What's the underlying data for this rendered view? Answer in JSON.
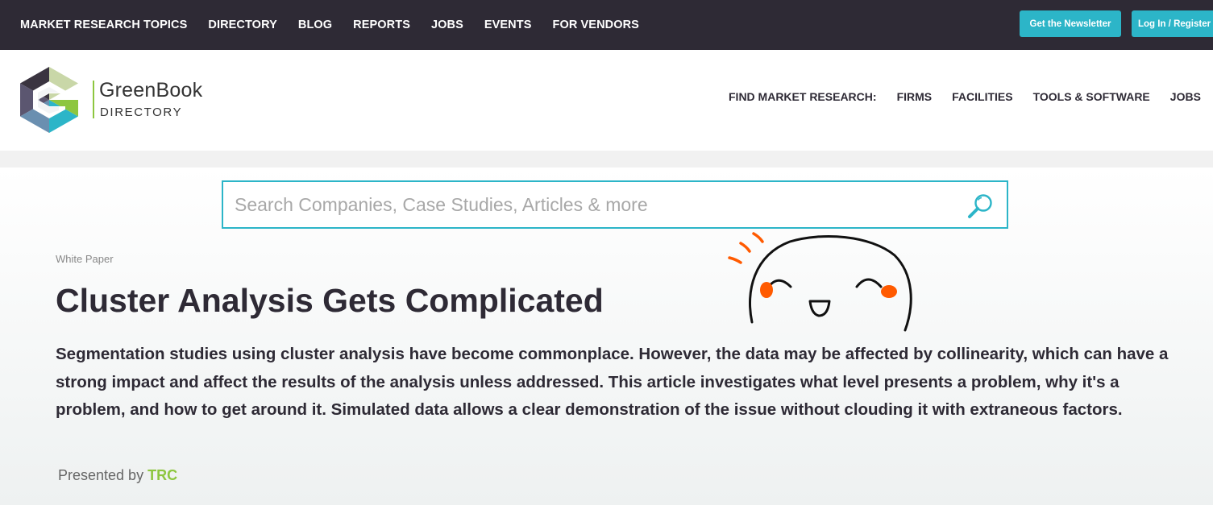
{
  "topbar": {
    "nav": [
      "MARKET RESEARCH TOPICS",
      "DIRECTORY",
      "BLOG",
      "REPORTS",
      "JOBS",
      "EVENTS",
      "FOR VENDORS"
    ],
    "newsletter_label": "Get the Newsletter",
    "login_label": "Log In / Register"
  },
  "header": {
    "logo_name": "GreenBook",
    "logo_sub": "DIRECTORY",
    "find_label": "FIND MARKET RESEARCH:",
    "find_links": [
      "FIRMS",
      "FACILITIES",
      "TOOLS & SOFTWARE",
      "JOBS"
    ]
  },
  "search": {
    "placeholder": "Search Companies, Case Studies, Articles & more"
  },
  "article": {
    "type": "White Paper",
    "title": "Cluster Analysis Gets Complicated",
    "description": "Segmentation studies using cluster analysis have become commonplace. However, the data may be affected by collinearity, which can have a strong impact and affect the results of the analysis unless addressed. This article investigates what level presents a problem, why it's a problem, and how to get around it. Simulated data allows a clear demonstration of the issue without clouding it with extraneous factors.",
    "presented_prefix": "Presented by",
    "presenter": "TRC"
  },
  "colors": {
    "topbar": "#2e2a35",
    "accent_teal": "#2cb5c8",
    "accent_green": "#8dc63f",
    "doodle_orange": "#ff5a00"
  },
  "icons": {
    "search": "search-icon",
    "logo": "greenbook-logo-icon",
    "doodle": "smiley-doodle-icon"
  }
}
